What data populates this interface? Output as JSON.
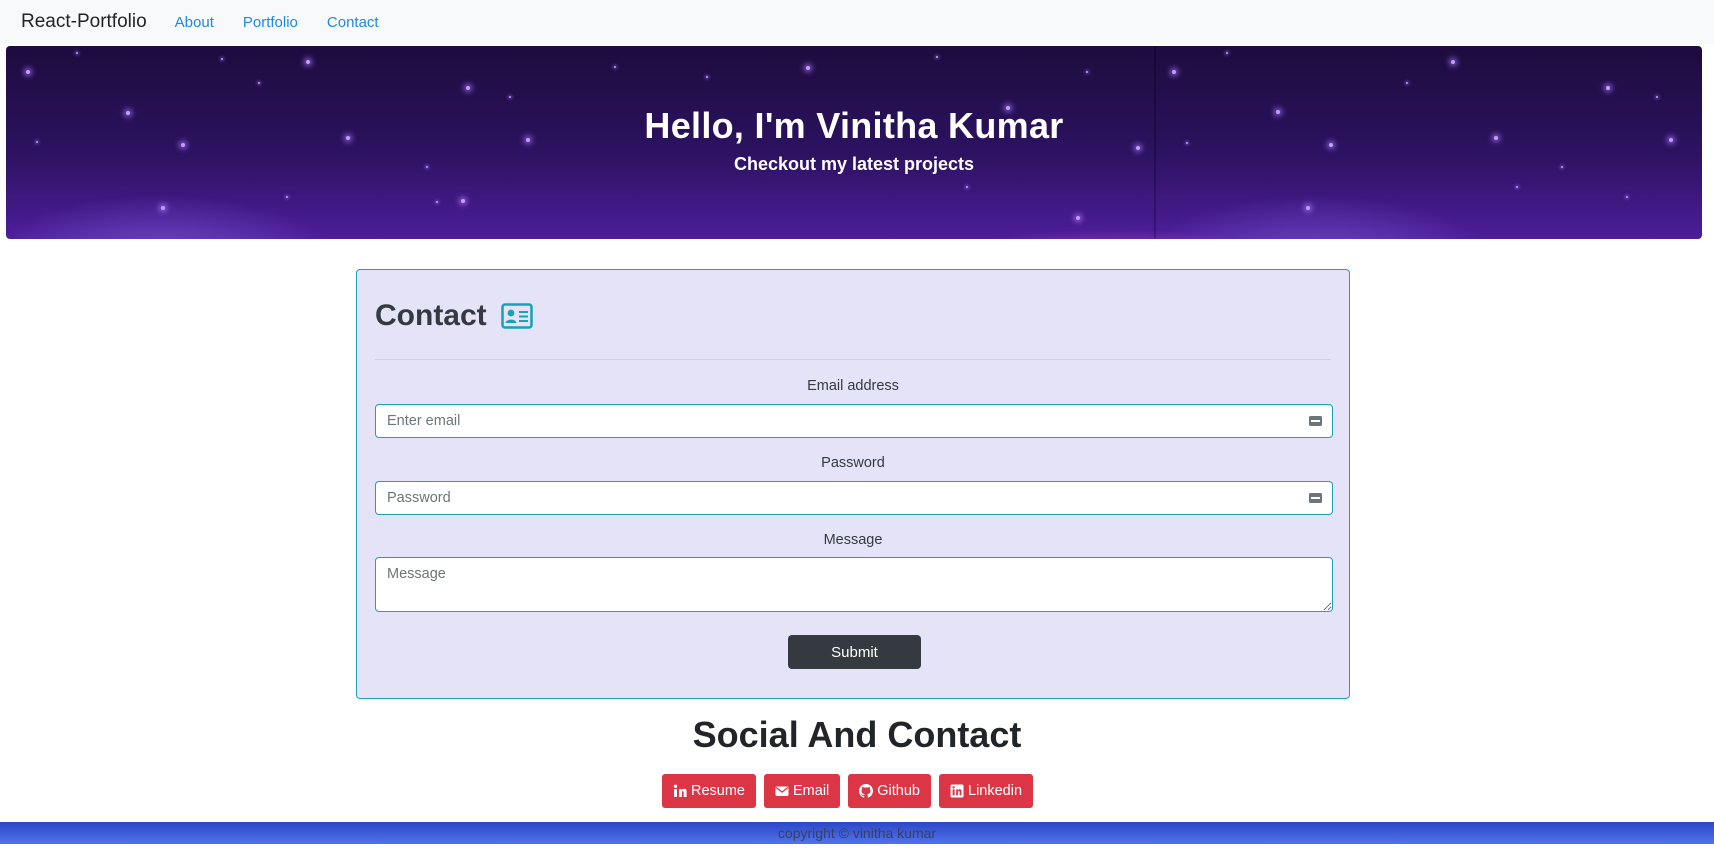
{
  "navbar": {
    "brand": "React-Portfolio",
    "links": [
      "About",
      "Portfolio",
      "Contact"
    ]
  },
  "hero": {
    "title": "Hello, I'm Vinitha Kumar",
    "subtitle": "Checkout my latest projects"
  },
  "contact": {
    "title": "Contact",
    "icon": "contact-card-icon",
    "email": {
      "label": "Email address",
      "placeholder": "Enter email",
      "value": ""
    },
    "password": {
      "label": "Password",
      "placeholder": "Password",
      "value": ""
    },
    "message": {
      "label": "Message",
      "placeholder": "Message",
      "value": ""
    },
    "submit_label": "Submit"
  },
  "social": {
    "title": "Social And Contact",
    "buttons": [
      {
        "label": "Resume",
        "icon": "linkedin-in-icon"
      },
      {
        "label": "Email",
        "icon": "envelope-icon"
      },
      {
        "label": "Github",
        "icon": "github-icon"
      },
      {
        "label": "Linkedin",
        "icon": "linkedin-square-icon"
      }
    ]
  },
  "footer": {
    "text": "copyright © vinitha kumar"
  },
  "colors": {
    "accent": "#17a2b8",
    "nav_link": "#1e88e5",
    "card_bg": "#e4e3f8",
    "submit_bg": "#343a40",
    "social_btn": "#dc3545",
    "footer_bg": "#3a5ad8"
  }
}
